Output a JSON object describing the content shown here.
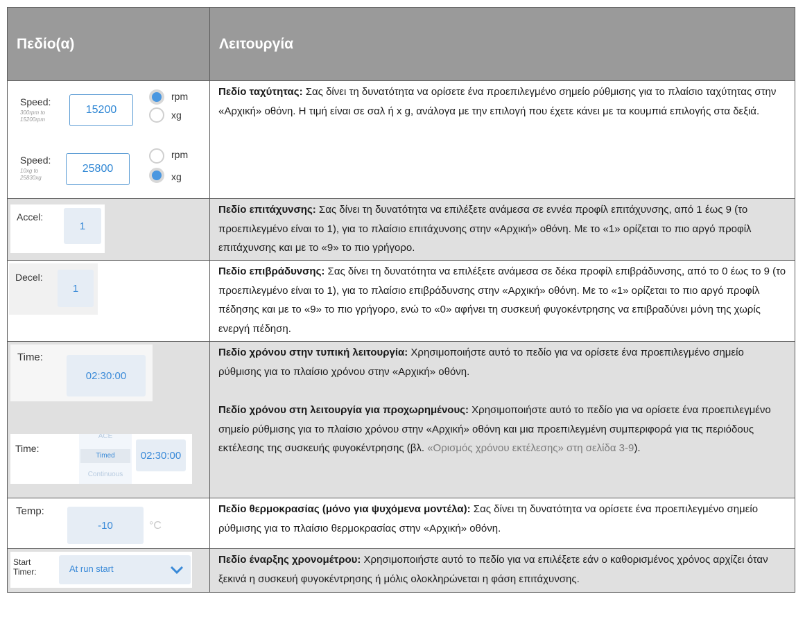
{
  "header": {
    "col1": "Πεδίο(α)",
    "col2": "Λειτουργία"
  },
  "speed": {
    "rpm_panel": {
      "label": "Speed:",
      "range": "300rpm to\n15200rpm",
      "value": "15200",
      "opt1": "rpm",
      "opt2": "xg",
      "selected": "rpm"
    },
    "xg_panel": {
      "label": "Speed:",
      "range": "10xg to\n25830xg",
      "value": "25800",
      "opt1": "rpm",
      "opt2": "xg",
      "selected": "xg"
    },
    "title": "Πεδίο ταχύτητας:",
    "text": " Σας δίνει τη δυνατότητα να ορίσετε ένα προεπιλεγμένο σημείο ρύθμισης για το πλαίσιο ταχύτητας στην «Αρχική» οθόνη. Η τιμή είναι σε σαλ ή x g, ανάλογα με την επιλογή που έχετε κάνει με τα κουμπιά επιλογής στα δεξιά."
  },
  "accel": {
    "label": "Accel:",
    "value": "1",
    "title": "Πεδίο επιτάχυνσης:",
    "text": " Σας δίνει τη δυνατότητα να επιλέξετε ανάμεσα σε εννέα προφίλ επιτάχυνσης, από 1 έως 9 (το προεπιλεγμένο είναι το 1), για το πλαίσιο επιτάχυνσης στην «Αρχική» οθόνη. Με το «1» ορίζεται το πιο αργό προφίλ επιτάχυνσης και με το «9» το πιο γρήγορο."
  },
  "decel": {
    "label": "Decel:",
    "value": "1",
    "title": "Πεδίο επιβράδυνσης:",
    "text": " Σας δίνει τη δυνατότητα να επιλέξετε ανάμεσα σε δέκα προφίλ επιβράδυνσης, από το 0 έως το 9 (το προεπιλεγμένο είναι το 1), για το πλαίσιο επιβράδυνσης στην «Αρχική» οθόνη. Με το «1» ορίζεται το πιο αργό προφίλ πέδησης και με το «9» το πιο γρήγορο, ενώ το «0» αφήνει τη συσκευή φυγοκέντρησης να επιβραδύνει μόνη της χωρίς ενεργή πέδηση."
  },
  "time": {
    "std_label": "Time:",
    "std_value": "02:30:00",
    "adv_label": "Time:",
    "adv_opt1": "ACE",
    "adv_opt2": "Timed",
    "adv_opt3": "Continuous",
    "adv_value": "02:30:00",
    "title1": "Πεδίο χρόνου στην τυπική λειτουργία:",
    "text1": " Χρησιμοποιήστε αυτό το πεδίο για να ορίσετε ένα προεπιλεγμένο σημείο ρύθμισης για το πλαίσιο χρόνου στην «Αρχική» οθόνη.",
    "title2": "Πεδίο χρόνου στη λειτουργία για προχωρημένους:",
    "text2": " Χρησιμοποιήστε αυτό το πεδίο για να ορίσετε ένα προεπιλεγμένο σημείο ρύθμισης για το πλαίσιο χρόνου στην «Αρχική» οθόνη και μια προεπιλεγμένη συμπεριφορά για τις περιόδους εκτέλεσης της συσκευής φυγοκέντρησης (βλ. ",
    "link": "«Ορισμός χρόνου εκτέλεσης» στη σελίδα 3-9",
    "text2_end": ")."
  },
  "temp": {
    "label": "Temp:",
    "value": "-10",
    "unit": "°C",
    "title": "Πεδίο θερμοκρασίας (μόνο για ψυχόμενα μοντέλα):",
    "text": " Σας δίνει τη δυνατότητα να ορίσετε ένα προεπιλεγμένο σημείο ρύθμισης για το πλαίσιο θερμοκρασίας στην «Αρχική» οθόνη."
  },
  "timer": {
    "label": "Start\nTimer:",
    "value": "At run start",
    "title": "Πεδίο έναρξης χρονομέτρου:",
    "text": " Χρησιμοποιήστε αυτό το πεδίο για να επιλέξετε εάν ο καθορισμένος χρόνος αρχίζει όταν ξεκινά η συσκευή φυγοκέντρησης ή μόλις ολοκληρώνεται η φάση επιτάχυνσης."
  }
}
